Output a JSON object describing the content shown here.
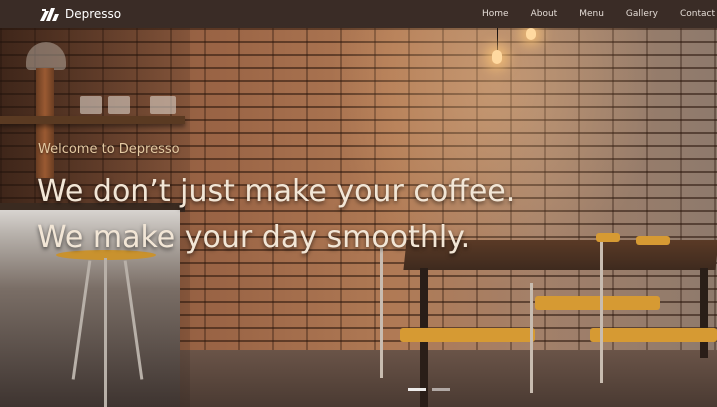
{
  "brand": {
    "name": "Depresso",
    "icon": "depresso-logo-icon"
  },
  "nav": {
    "items": [
      {
        "label": "Home"
      },
      {
        "label": "About"
      },
      {
        "label": "Menu"
      },
      {
        "label": "Gallery"
      },
      {
        "label": "Contact"
      }
    ]
  },
  "hero": {
    "welcome": "Welcome to Depresso",
    "headline_line1": "We don’t just make your coffee.",
    "headline_line2": "We make your day smoothly."
  },
  "colors": {
    "navbar": "#3a2c26",
    "nav_text": "#e4dcd6",
    "welcome_text": "#e4c9a2",
    "headline_text": "#f2e6d6"
  }
}
